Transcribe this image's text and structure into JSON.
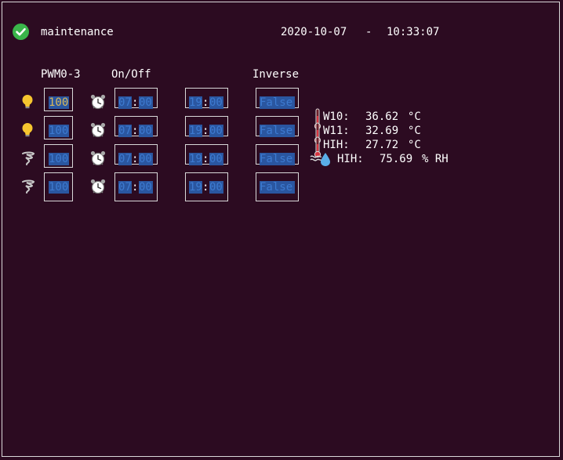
{
  "header": {
    "status_text": "maintenance",
    "date": "2020-10-07",
    "separator": "-",
    "time": "10:33:07",
    "status_icon": "check-circle-icon",
    "status_color": "#3ab54a"
  },
  "columns": {
    "pwm": "PWM0-3",
    "onoff": "On/Off",
    "inverse": "Inverse"
  },
  "channels": [
    {
      "icon": "lightbulb-icon",
      "pwm": "100",
      "on_h": "07",
      "on_m": "00",
      "off_h": "19",
      "off_m": "00",
      "inverse": "False"
    },
    {
      "icon": "lightbulb-icon",
      "pwm": "100",
      "on_h": "07",
      "on_m": "00",
      "off_h": "19",
      "off_m": "00",
      "inverse": "False"
    },
    {
      "icon": "fan-icon",
      "pwm": "100",
      "on_h": "07",
      "on_m": "00",
      "off_h": "19",
      "off_m": "00",
      "inverse": "False"
    },
    {
      "icon": "fan-icon",
      "pwm": "100",
      "on_h": "07",
      "on_m": "00",
      "off_h": "19",
      "off_m": "00",
      "inverse": "False"
    }
  ],
  "sensors": [
    {
      "label": "W10:",
      "value": "36.62",
      "unit": "°C",
      "icon": "thermometer-icon"
    },
    {
      "label": "W11:",
      "value": "32.69",
      "unit": "°C",
      "icon": "thermometer-icon"
    },
    {
      "label": "HIH:",
      "value": "27.72",
      "unit": "°C",
      "icon": "thermometer-icon"
    },
    {
      "label": "HIH:",
      "value": "75.69",
      "unit": "% RH",
      "icon": "humidity-icon"
    }
  ],
  "colors": {
    "background": "#2c0b21",
    "field_bg": "#2a56a0",
    "field_text": "#3d7ad0",
    "active_field_text": "#d9b85a"
  }
}
